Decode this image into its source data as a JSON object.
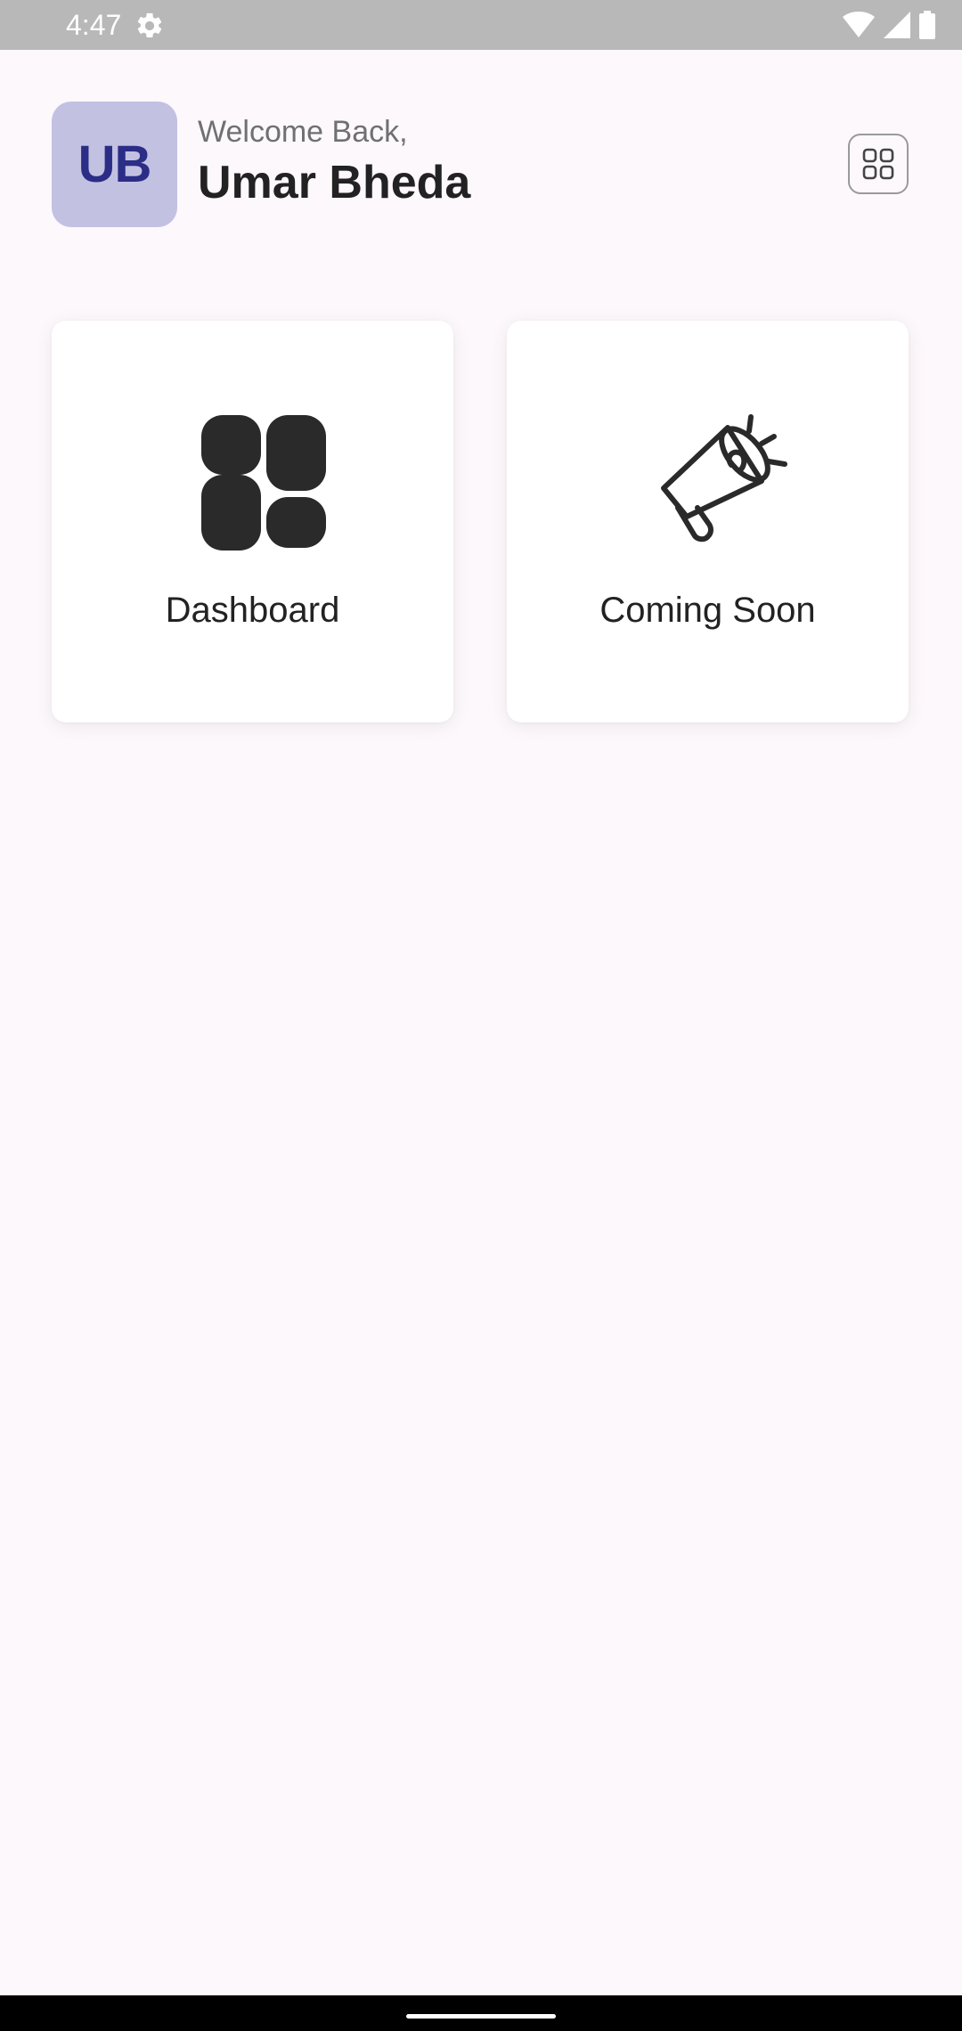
{
  "status_bar": {
    "time": "4:47",
    "icons": [
      "settings-icon",
      "wifi-icon",
      "signal-icon",
      "battery-icon"
    ]
  },
  "header": {
    "avatar_initials": "UB",
    "welcome_text": "Welcome Back,",
    "user_name": "Umar Bheda",
    "menu_icon": "grid-icon"
  },
  "cards": [
    {
      "label": "Dashboard",
      "icon": "dashboard-icon"
    },
    {
      "label": "Coming Soon",
      "icon": "megaphone-icon"
    }
  ],
  "colors": {
    "background": "#fdf8fc",
    "avatar_bg": "#c2c1e2",
    "avatar_text": "#2b2d86",
    "text_primary": "#222222",
    "text_secondary": "#707070",
    "status_bar": "#b8b8b8"
  }
}
